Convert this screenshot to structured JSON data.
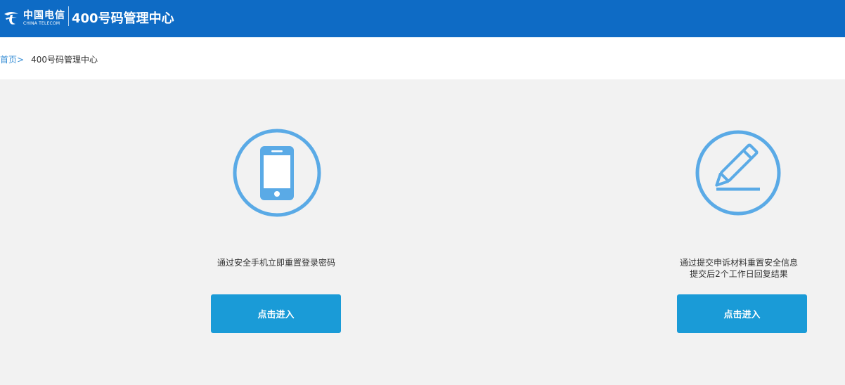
{
  "header": {
    "logo_cn": "中国电信",
    "logo_en": "CHINA TELECOM",
    "title": "400号码管理中心"
  },
  "breadcrumb": {
    "home": "首页",
    "separator": ">",
    "current": "400号码管理中心"
  },
  "options": [
    {
      "icon": "smartphone-icon",
      "desc_line1": "通过安全手机立即重置登录密码",
      "desc_line2": "",
      "button": "点击进入"
    },
    {
      "icon": "pencil-edit-icon",
      "desc_line1": "通过提交申诉材料重置安全信息",
      "desc_line2": "提交后2个工作日回复结果",
      "button": "点击进入"
    }
  ],
  "colors": {
    "header_bg": "#0e6bc5",
    "accent": "#1a9bd7",
    "icon": "#5aaae6",
    "page_bg": "#f2f2f2"
  }
}
